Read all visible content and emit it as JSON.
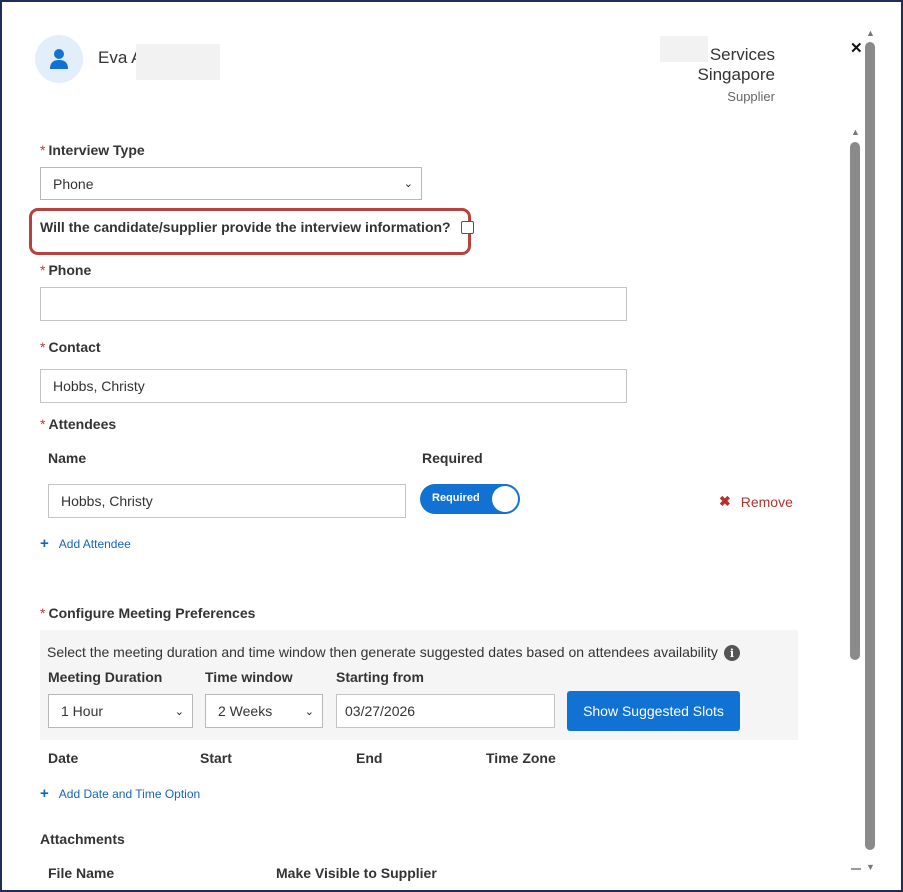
{
  "header": {
    "candidate_name": "Eva A",
    "company_name": "Services Singapore",
    "company_line1": "Services",
    "company_line2": "Singapore",
    "role": "Supplier",
    "close_glyph": "✕"
  },
  "form": {
    "interview_type": {
      "label": "Interview Type",
      "value": "Phone"
    },
    "supplier_provides": {
      "label": "Will the candidate/supplier provide the interview information?",
      "checked": false
    },
    "phone": {
      "label": "Phone",
      "value": ""
    },
    "contact": {
      "label": "Contact",
      "value": "Hobbs, Christy"
    },
    "attendees": {
      "label": "Attendees",
      "col_name": "Name",
      "col_required": "Required",
      "rows": [
        {
          "name": "Hobbs, Christy",
          "required_label": "Required",
          "required": true,
          "remove_label": "Remove"
        }
      ],
      "add_label": "Add Attendee"
    },
    "meeting": {
      "label": "Configure Meeting Preferences",
      "help_text": "Select the meeting duration and time window then generate suggested dates based on attendees availability",
      "duration": {
        "label": "Meeting Duration",
        "value": "1 Hour"
      },
      "window": {
        "label": "Time window",
        "value": "2 Weeks"
      },
      "start": {
        "label": "Starting from",
        "value": "03/27/2026"
      },
      "show_slots_label": "Show Suggested Slots",
      "columns": [
        "Date",
        "Start",
        "End",
        "Time Zone"
      ],
      "add_option_label": "Add Date and Time Option"
    },
    "attachments": {
      "label": "Attachments",
      "col_file": "File Name",
      "col_visible": "Make Visible to Supplier"
    }
  },
  "colors": {
    "primary": "#1272d3",
    "required_star": "#c23934",
    "highlight_border": "#b7423b",
    "remove": "#b4312c",
    "link": "#1565c0"
  }
}
